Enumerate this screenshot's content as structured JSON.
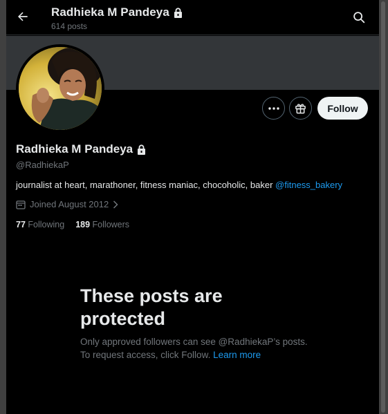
{
  "header": {
    "title": "Radhieka M Pandeya",
    "posts_count": "614 posts"
  },
  "profile": {
    "name": "Radhieka M Pandeya",
    "handle": "@RadhiekaP",
    "bio_text": "journalist at heart, marathoner, fitness maniac, chocoholic, baker ",
    "bio_mention": "@fitness_bakery",
    "joined": "Joined August 2012",
    "following_count": "77",
    "following_label": "Following",
    "followers_count": "189",
    "followers_label": "Followers"
  },
  "actions": {
    "follow_label": "Follow"
  },
  "protected": {
    "title": "These posts are protected",
    "message": "Only approved followers can see @RadhiekaP’s posts. To request access, click Follow. ",
    "learn_more": "Learn more"
  },
  "colors": {
    "background": "#000000",
    "accent": "#1d9bf0",
    "muted_text": "#71767b",
    "banner": "#333639"
  },
  "icons": [
    "back-arrow-icon",
    "lock-icon",
    "search-icon",
    "more-icon",
    "gift-icon",
    "calendar-icon",
    "chevron-right-icon"
  ]
}
